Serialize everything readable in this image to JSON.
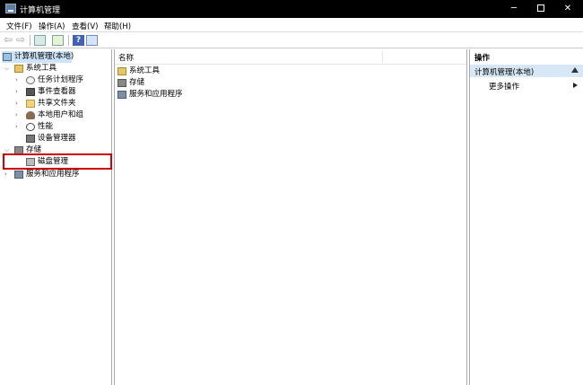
{
  "window": {
    "title": "计算机管理",
    "minimize_glyph": "─",
    "close_glyph": "✕"
  },
  "menu": [
    "文件(F)",
    "操作(A)",
    "查看(V)",
    "帮助(H)"
  ],
  "toolbar": {
    "back_glyph": "⇦",
    "forward_glyph": "⇨",
    "help_glyph": "?"
  },
  "tree": {
    "root": "计算机管理(本地)",
    "system_tools": "系统工具",
    "system_tools_children": [
      "任务计划程序",
      "事件查看器",
      "共享文件夹",
      "本地用户和组",
      "性能",
      "设备管理器"
    ],
    "storage": "存储",
    "disk_management": "磁盘管理",
    "services": "服务和应用程序"
  },
  "list": {
    "column_name": "名称",
    "items": [
      "系统工具",
      "存储",
      "服务和应用程序"
    ]
  },
  "actions": {
    "header": "操作",
    "section": "计算机管理(本地)",
    "more": "更多操作"
  },
  "colors": {
    "highlight_box": "#d40000",
    "section_bg": "#d7e7f6",
    "titlebar_bg": "#000000"
  }
}
